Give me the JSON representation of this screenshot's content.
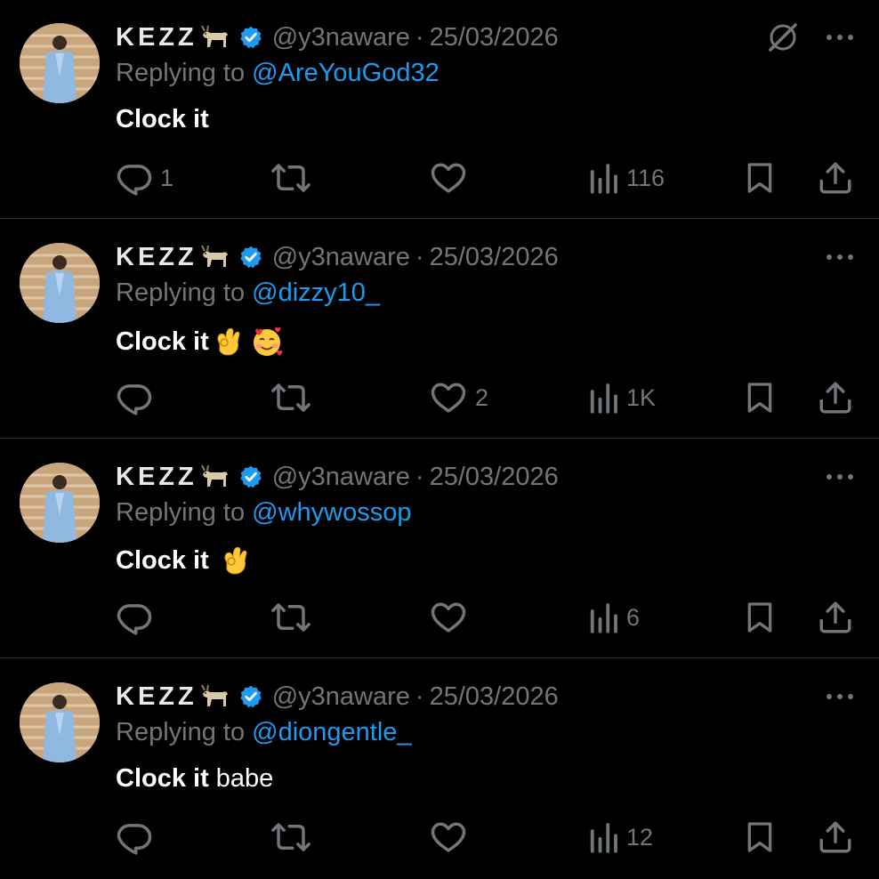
{
  "colors": {
    "background": "#000000",
    "text_primary": "#e7e9ea",
    "text_secondary": "#71767b",
    "mention": "#1d9bf0",
    "verified": "#1d9bf0",
    "divider": "#2f3336"
  },
  "tweets": [
    {
      "author_name": "KEZZ",
      "handle": "@y3naware",
      "separator": "·",
      "date": "25/03/2026",
      "replying_prefix": "Replying to ",
      "replying_to": "@AreYouGod32",
      "text_bold": "Clock it",
      "text_rest": "",
      "emojis": [],
      "show_grok_icon": true,
      "reply_count": "1",
      "retweet_count": "",
      "like_count": "",
      "view_count": "116"
    },
    {
      "author_name": "KEZZ",
      "handle": "@y3naware",
      "separator": "·",
      "date": "25/03/2026",
      "replying_prefix": "Replying to ",
      "replying_to": "@dizzy10_",
      "text_bold": "Clock it",
      "text_rest": "",
      "emojis": [
        "ok-hand-emoji",
        "smiling-face-with-hearts-emoji"
      ],
      "show_grok_icon": false,
      "reply_count": "",
      "retweet_count": "",
      "like_count": "2",
      "view_count": "1K"
    },
    {
      "author_name": "KEZZ",
      "handle": "@y3naware",
      "separator": "·",
      "date": "25/03/2026",
      "replying_prefix": "Replying to ",
      "replying_to": "@whywossop",
      "text_bold": "Clock it",
      "text_rest": "",
      "emojis": [
        "ok-hand-emoji"
      ],
      "show_grok_icon": false,
      "reply_count": "",
      "retweet_count": "",
      "like_count": "",
      "view_count": "6"
    },
    {
      "author_name": "KEZZ",
      "handle": "@y3naware",
      "separator": "·",
      "date": "25/03/2026",
      "replying_prefix": "Replying to ",
      "replying_to": "@diongentle_",
      "text_bold": "Clock it",
      "text_rest": "babe",
      "emojis": [],
      "show_grok_icon": false,
      "reply_count": "",
      "retweet_count": "",
      "like_count": "",
      "view_count": "12"
    }
  ],
  "icons": {
    "avatar": "avatar",
    "name_emoji": "goat-emoji",
    "verified": "verified-badge-icon",
    "grok": "grok-icon",
    "more": "more-options-icon",
    "reply": "reply-icon",
    "retweet": "retweet-icon",
    "like": "like-icon",
    "views": "views-icon",
    "bookmark": "bookmark-icon",
    "share": "share-icon"
  }
}
